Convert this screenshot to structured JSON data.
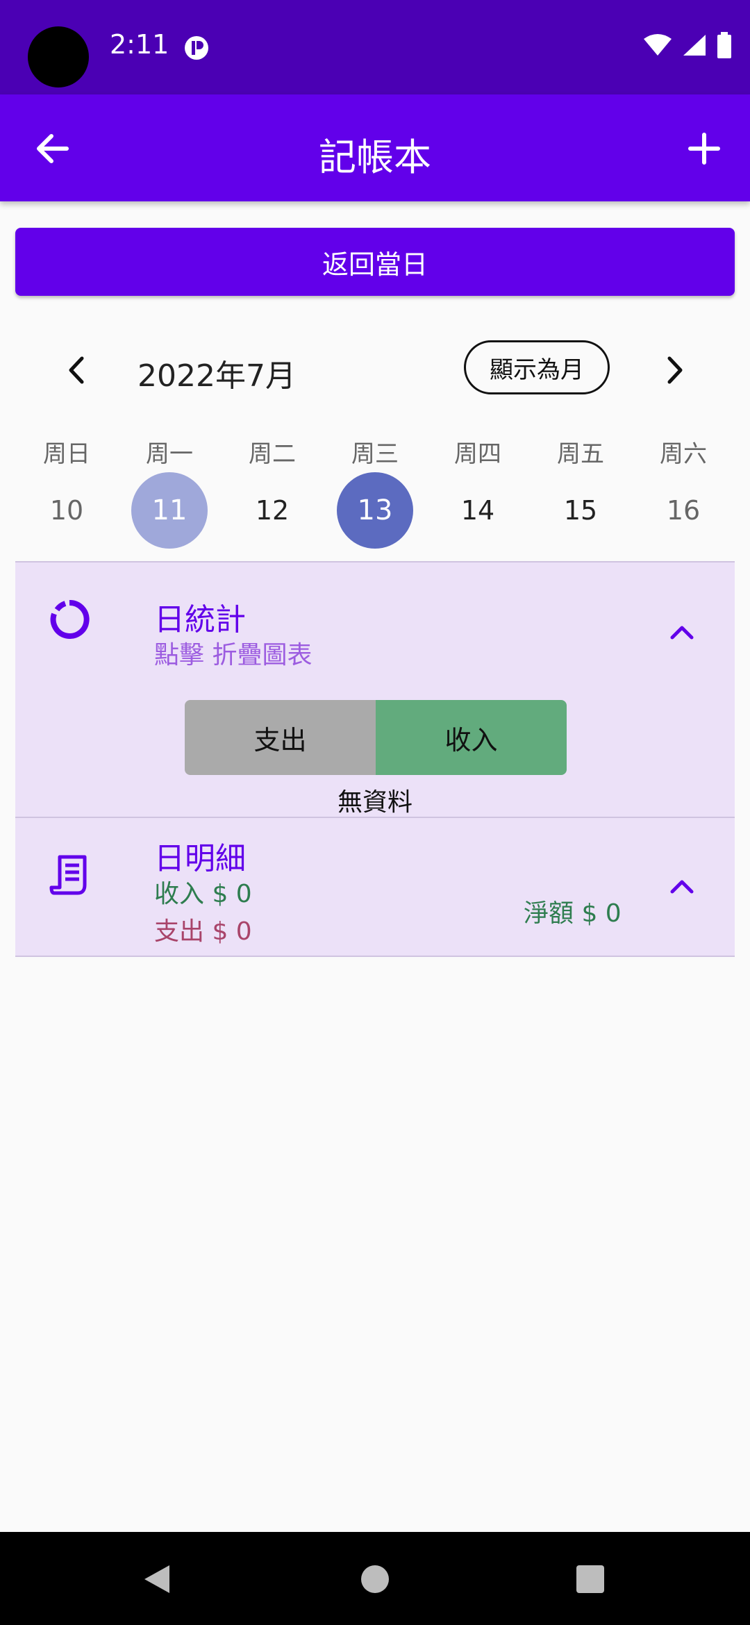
{
  "status_bar": {
    "time": "2:11"
  },
  "app_bar": {
    "title": "記帳本"
  },
  "today_button": {
    "label": "返回當日"
  },
  "calendar": {
    "month_label": "2022年7月",
    "mode_button": "顯示為月",
    "weekdays": [
      "周日",
      "周一",
      "周二",
      "周三",
      "周四",
      "周五",
      "周六"
    ],
    "days": [
      "10",
      "11",
      "12",
      "13",
      "14",
      "15",
      "16"
    ]
  },
  "stats": {
    "title": "日統計",
    "subtitle": "點擊 折疊圖表",
    "tab_expense": "支出",
    "tab_income": "收入",
    "no_data": "無資料"
  },
  "details": {
    "title": "日明細",
    "income": "收入 $ 0",
    "expense": "支出 $ 0",
    "net": "淨額 $ 0"
  },
  "colors": {
    "status_bar": "#4b00b4",
    "primary": "#6200ea",
    "panel_bg": "#ece1f8",
    "income_tab": "#62ab7d",
    "expense_tab": "#aaaaaa",
    "today_circle": "#5c6bc0",
    "selected_circle": "#9fa8da"
  }
}
